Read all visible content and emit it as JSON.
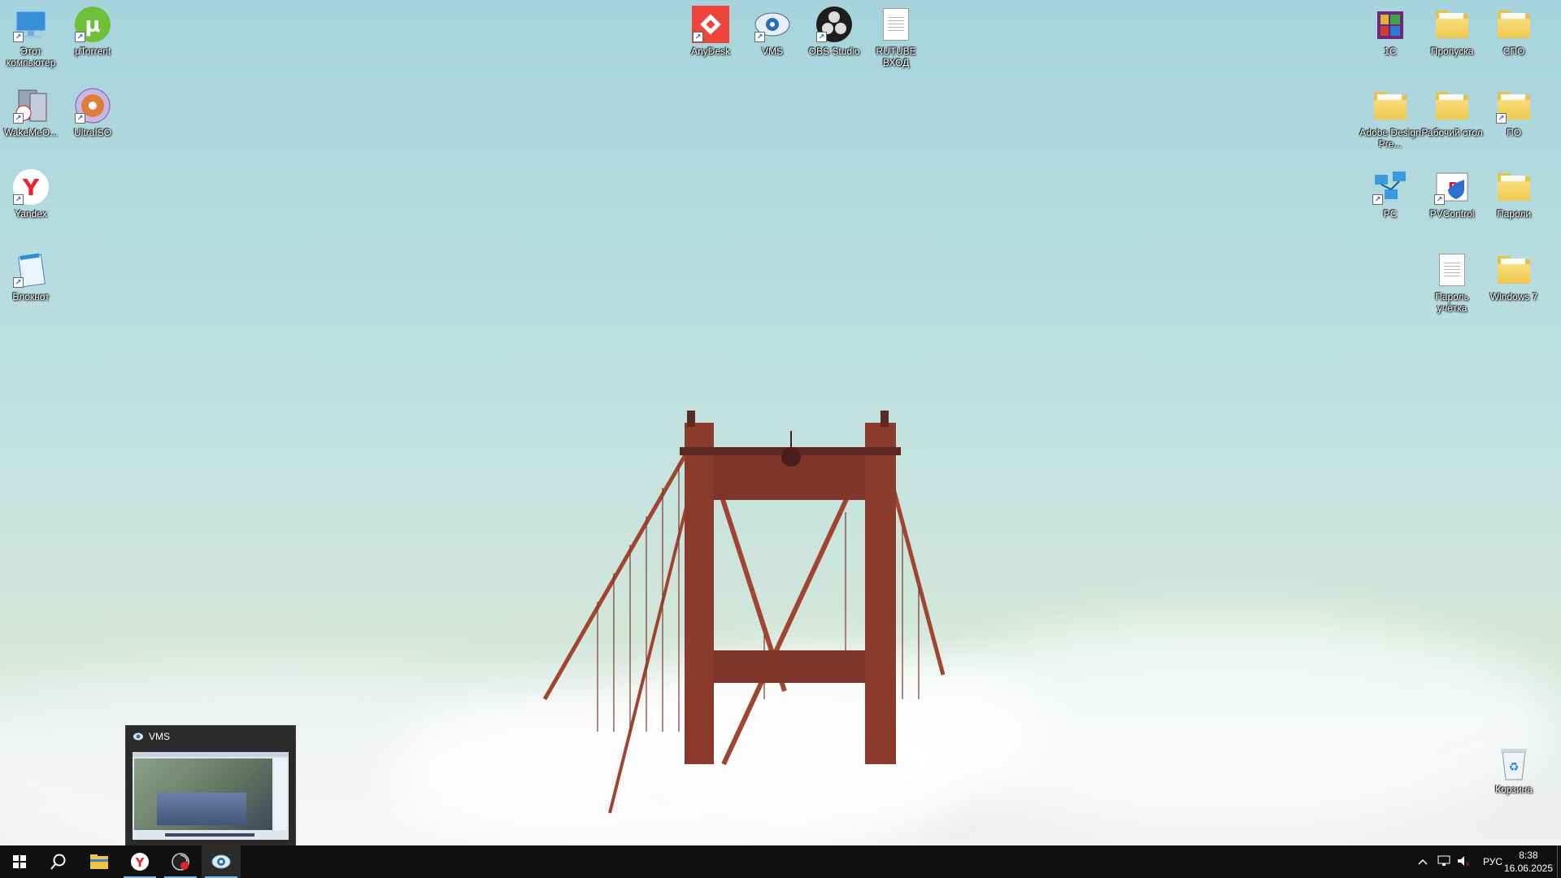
{
  "desktop": {
    "icons_left": [
      {
        "label": "Этот компьютер",
        "icon": "computer-icon"
      },
      {
        "label": "µTorrent",
        "icon": "utorrent-icon"
      },
      {
        "label": "WakeMeO...",
        "icon": "wakemeonlan-icon"
      },
      {
        "label": "UltraISO",
        "icon": "ultraiso-icon"
      },
      {
        "label": "Yandex",
        "icon": "yandex-icon"
      },
      {
        "label": "Блокнот",
        "icon": "notepad-icon"
      }
    ],
    "icons_top": [
      {
        "label": "AnyDesk",
        "icon": "anydesk-icon"
      },
      {
        "label": "VMS",
        "icon": "vms-icon"
      },
      {
        "label": "OBS Studio",
        "icon": "obs-icon"
      },
      {
        "label": "RUTUBE ВХОД",
        "icon": "text-document-icon"
      }
    ],
    "icons_right": [
      {
        "label": "1С",
        "icon": "onec-folder-icon"
      },
      {
        "label": "Пропуска",
        "icon": "folder-icon"
      },
      {
        "label": "СПО",
        "icon": "folder-icon"
      },
      {
        "label": "Adobe Design Pre...",
        "icon": "folder-icon"
      },
      {
        "label": "Рабочий стол",
        "icon": "folder-icon"
      },
      {
        "label": "ПО",
        "icon": "folder-icon"
      },
      {
        "label": "PC",
        "icon": "network-pc-icon"
      },
      {
        "label": "PVControl",
        "icon": "pvcontrol-icon"
      },
      {
        "label": "Пароли",
        "icon": "folder-icon"
      },
      {
        "label": "Пароль учётка",
        "icon": "text-document-icon"
      },
      {
        "label": "Windows 7",
        "icon": "folder-icon"
      },
      {
        "label": "Корзина",
        "icon": "recycle-bin-icon"
      }
    ]
  },
  "thumbnail": {
    "title": "VMS"
  },
  "taskbar": {
    "language": "РУС",
    "time": "8:38",
    "date": "16.06.2025",
    "buttons": [
      "start-button",
      "search-button",
      "file-explorer",
      "yandex-browser",
      "obs-studio",
      "vms"
    ]
  },
  "colors": {
    "taskbar_bg": "#101010",
    "active_indicator": "#76b9ed",
    "bridge": "#8e3a2c",
    "sky_top": "#a6d3dc"
  }
}
